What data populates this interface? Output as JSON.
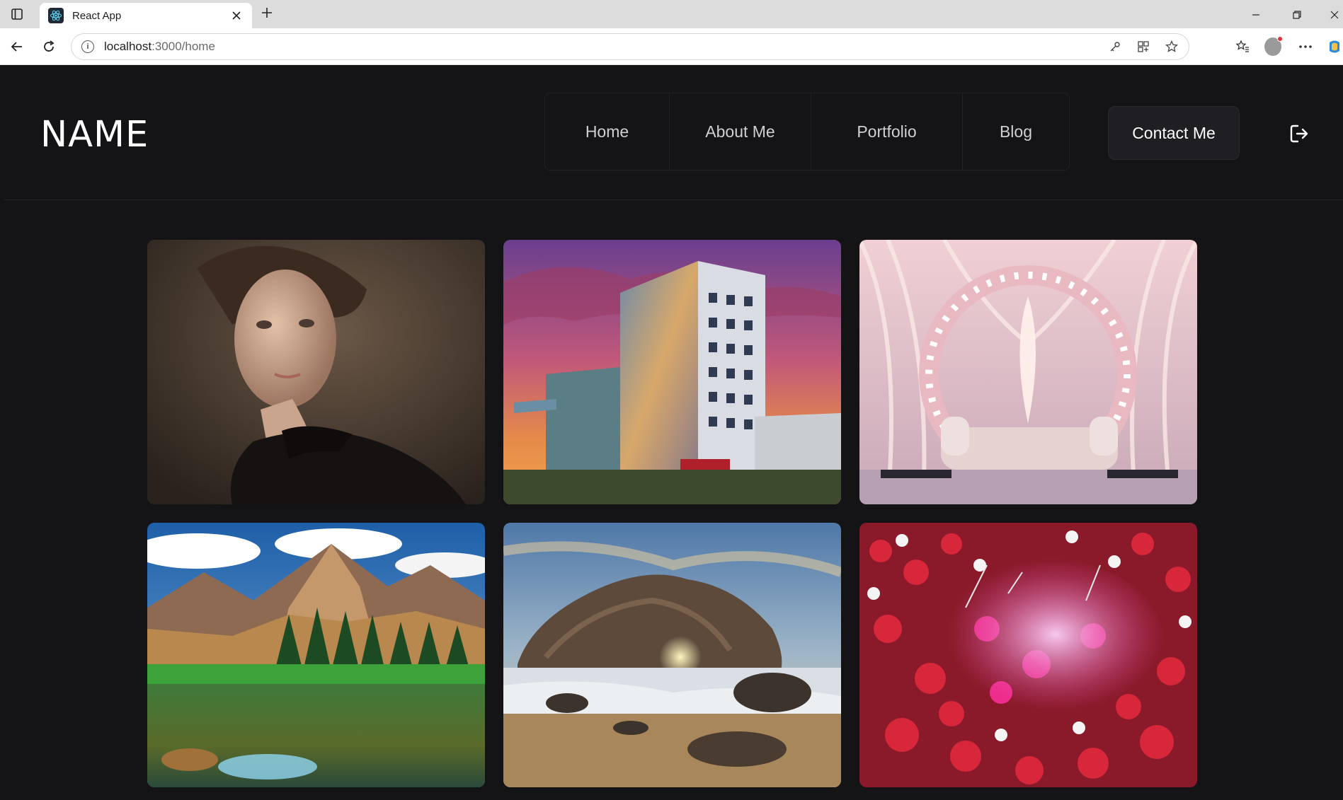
{
  "browser": {
    "tab_title": "React App",
    "url_host": "localhost",
    "url_path": ":3000/home"
  },
  "site": {
    "brand": "NAME",
    "nav": [
      "Home",
      "About Me",
      "Portfolio",
      "Blog"
    ],
    "contact_label": "Contact Me"
  },
  "gallery": {
    "photos": [
      {
        "name": "portrait-photo"
      },
      {
        "name": "hotel-building-photo"
      },
      {
        "name": "wedding-stage-photo"
      },
      {
        "name": "mountain-lake-photo"
      },
      {
        "name": "beach-rock-sunset-photo"
      },
      {
        "name": "holi-festival-photo"
      }
    ]
  },
  "colors": {
    "background": "#141416",
    "nav_text": "#cfcfd4",
    "contact_bg": "#1f1f23"
  }
}
